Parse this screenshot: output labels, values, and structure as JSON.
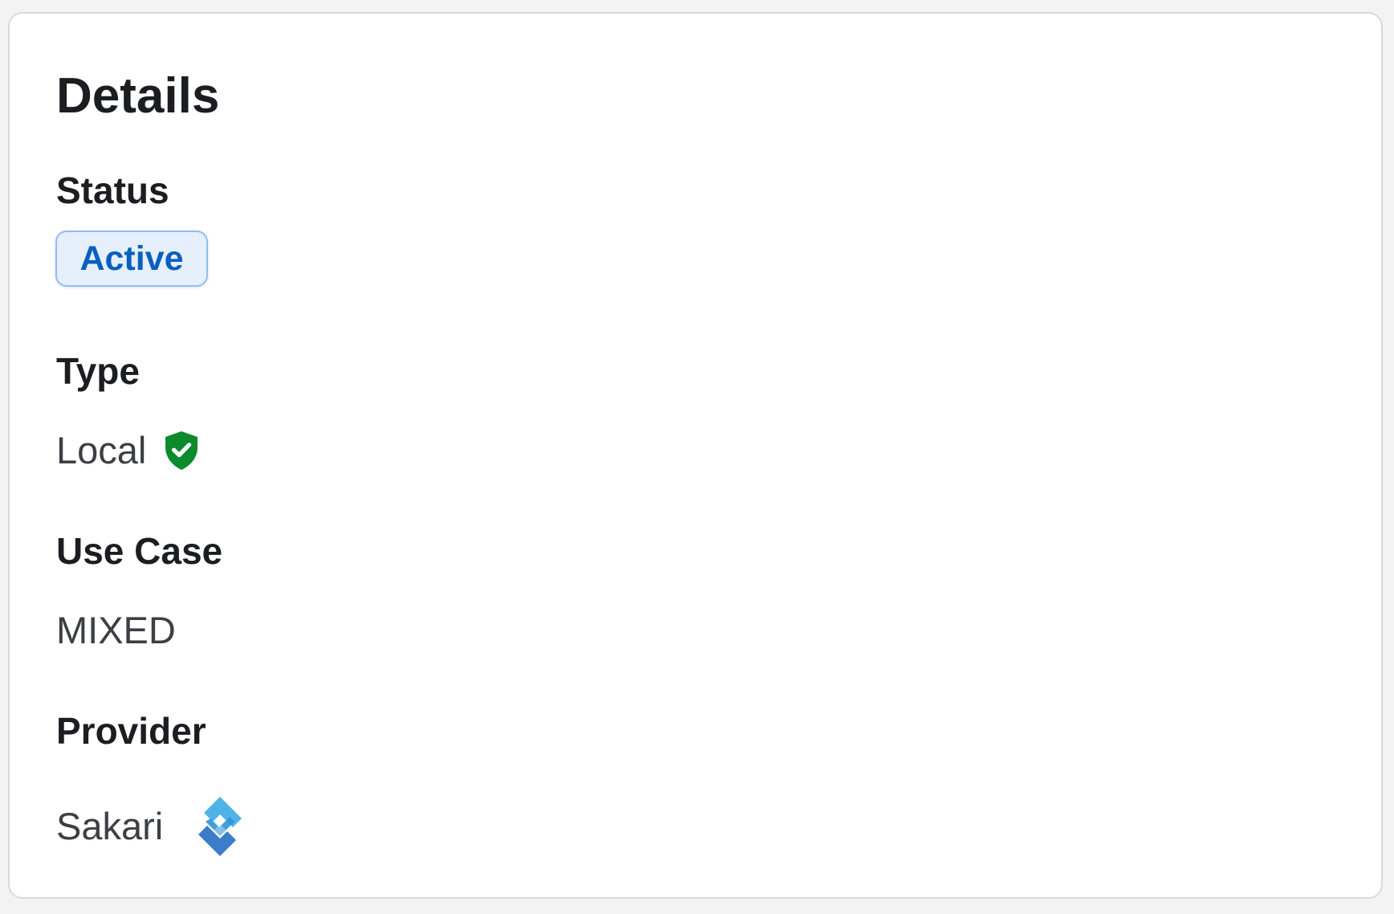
{
  "details": {
    "title": "Details",
    "status": {
      "label": "Status",
      "value": "Active",
      "colors": {
        "text": "#0a5fbf",
        "background": "#e6f0fd",
        "border": "#93bcf1"
      }
    },
    "type": {
      "label": "Type",
      "value": "Local",
      "icon": "shield-check-icon",
      "icon_color": "#0d8a2c"
    },
    "use_case": {
      "label": "Use Case",
      "value": "MIXED"
    },
    "provider": {
      "label": "Provider",
      "value": "Sakari",
      "icon": "sakari-logo",
      "logo_colors": [
        "#4fb3e8",
        "#3d7cc9"
      ]
    }
  }
}
